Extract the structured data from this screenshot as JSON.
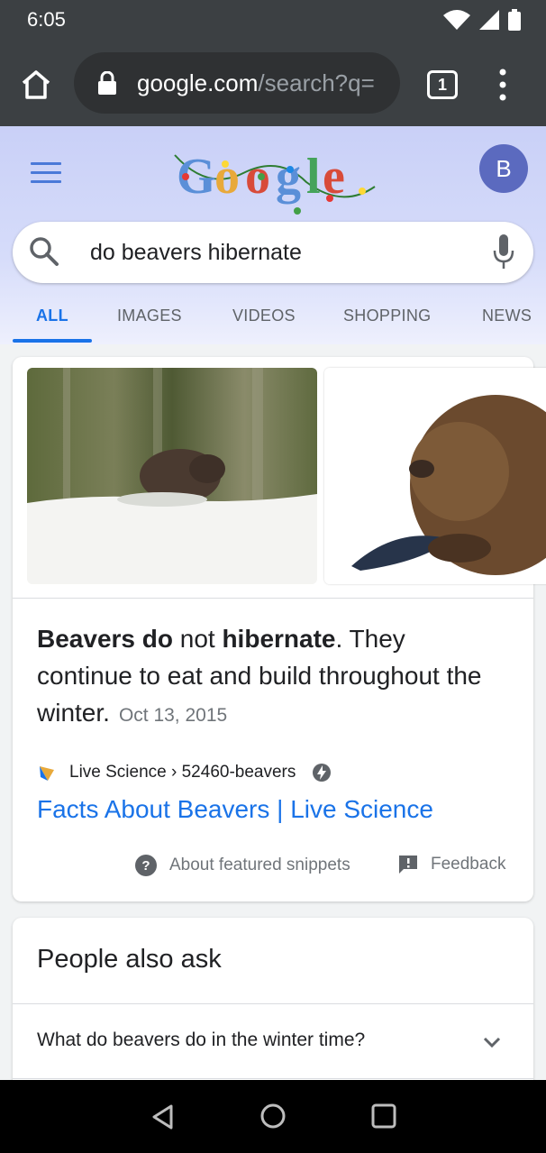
{
  "status_bar": {
    "time": "6:05"
  },
  "browser": {
    "url_domain": "google.com",
    "url_path": "/search?q=",
    "tab_count": "1"
  },
  "google": {
    "avatar_letter": "B",
    "query": "do beavers hibernate",
    "tabs": [
      {
        "label": "ALL",
        "active": true
      },
      {
        "label": "IMAGES",
        "active": false
      },
      {
        "label": "VIDEOS",
        "active": false
      },
      {
        "label": "SHOPPING",
        "active": false
      },
      {
        "label": "NEWS",
        "active": false
      }
    ]
  },
  "snippet": {
    "text_parts": [
      "Beavers do",
      " not ",
      "hibernate",
      ". They continue to eat and build throughout the winter."
    ],
    "date": "Oct 13, 2015",
    "source": "Live Science › 52460-beavers",
    "link_title": "Facts About Beavers | Live Science",
    "about_label": "About featured snippets",
    "feedback_label": "Feedback"
  },
  "people_also_ask": {
    "title": "People also ask",
    "questions": [
      "What do beavers do in the winter time?"
    ]
  },
  "colors": {
    "accent": "#1a73e8",
    "header_bg": "#c9d0f7",
    "avatar_bg": "#5b6abf",
    "chrome_bg": "#3c4043"
  }
}
